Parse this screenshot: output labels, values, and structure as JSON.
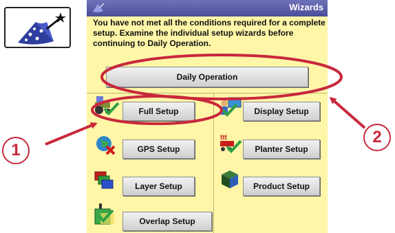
{
  "window": {
    "title": "Wizards"
  },
  "message": "You have not met all the conditions required for a complete setup. Examine the individual setup wizards before continuing to Daily Operation.",
  "buttons": {
    "daily_operation": "Daily Operation",
    "full_setup": "Full Setup",
    "display_setup": "Display Setup",
    "gps_setup": "GPS Setup",
    "planter_setup": "Planter Setup",
    "layer_setup": "Layer Setup",
    "product_setup": "Product Setup",
    "overlap_setup": "Overlap Setup"
  },
  "callouts": {
    "first": "1",
    "second": "2"
  },
  "colors": {
    "screen_bg": "#fff6a8",
    "titlebar": "#5a5ca6",
    "annotation": "#c8283c"
  },
  "icons": {
    "wizard": "wizard-hat-wand-icon",
    "titlebar": "wizard-hat-icon",
    "full_setup": "tractor-check-icon",
    "display_setup": "person-screen-check-icon",
    "gps_setup": "globe-x-icon",
    "planter_setup": "planter-check-icon",
    "layer_setup": "layers-icon",
    "product_setup": "product-box-icon",
    "overlap_setup": "overlap-check-icon"
  }
}
